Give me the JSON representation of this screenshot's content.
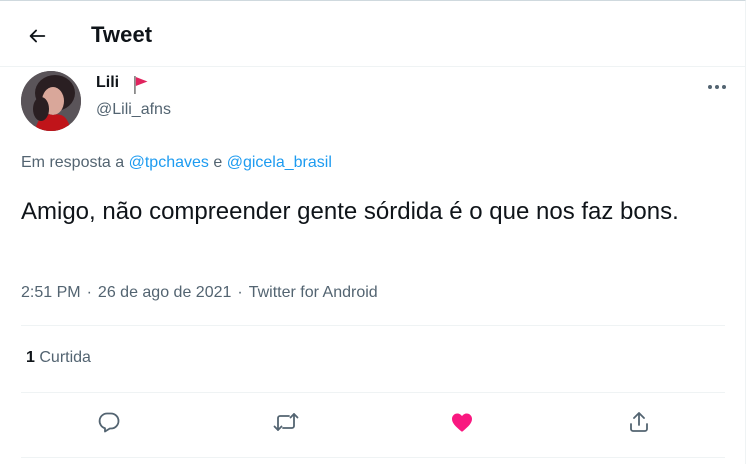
{
  "header": {
    "title": "Tweet"
  },
  "author": {
    "name": "Lili",
    "handle": "@Lili_afns"
  },
  "reply": {
    "prefix": "Em resposta a",
    "mention1": "@tpchaves",
    "conjunction": "e",
    "mention2": "@gicela_brasil"
  },
  "tweet": {
    "text": "Amigo, não compreender gente sórdida é o que nos faz bons."
  },
  "meta": {
    "time": "2:51 PM",
    "separator": "·",
    "date": "26 de ago de 2021",
    "source": "Twitter for Android"
  },
  "stats": {
    "likes_count": "1",
    "likes_label": "Curtida"
  },
  "icons": {
    "back": "arrow-left-icon",
    "more": "more-horizontal-icon",
    "flag": "red-flag-icon",
    "reply": "reply-bubble-icon",
    "retweet": "retweet-icon",
    "like": "heart-filled-icon",
    "share": "share-upload-icon"
  },
  "colors": {
    "accent": "#1d9bf0",
    "like": "#f91880",
    "secondary_text": "#536471",
    "flag": "#e0245e"
  }
}
